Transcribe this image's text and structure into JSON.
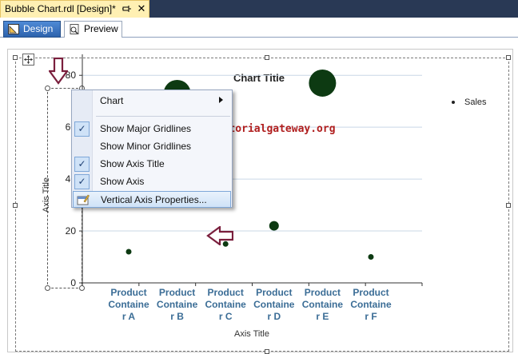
{
  "tabs": {
    "document_title": "Bubble Chart.rdl [Design]*",
    "pin_icon": "pin-icon",
    "close_icon": "close-icon",
    "close_glyph": "✕",
    "design_label": "Design",
    "preview_label": "Preview"
  },
  "context_menu": {
    "items": [
      {
        "label": "Chart",
        "checked": false,
        "submenu": true
      },
      {
        "label": "Show Major Gridlines",
        "checked": true
      },
      {
        "label": "Show Minor Gridlines",
        "checked": false
      },
      {
        "label": "Show Axis Title",
        "checked": true
      },
      {
        "label": "Show Axis",
        "checked": true
      },
      {
        "label": "Vertical Axis Properties...",
        "checked": false,
        "highlighted": true
      }
    ],
    "check_glyph": "✓"
  },
  "watermark": "©tutorialgateway.org",
  "chart_data": {
    "type": "scatter",
    "title": "Chart Title",
    "xlabel": "Axis Title",
    "ylabel": "Axis Title",
    "categories": [
      "Product Containe r A",
      "Product Containe r B",
      "Product Containe r C",
      "Product Containe r D",
      "Product Containe r E",
      "Product Containe r F"
    ],
    "category_lines": [
      [
        "Product",
        "Containe",
        "r A"
      ],
      [
        "Product",
        "Containe",
        "r B"
      ],
      [
        "Product",
        "Containe",
        "r C"
      ],
      [
        "Product",
        "Containe",
        "r D"
      ],
      [
        "Product",
        "Containe",
        "r E"
      ],
      [
        "Product",
        "Containe",
        "r F"
      ]
    ],
    "yticks": [
      "0",
      "20",
      "40",
      "60",
      "80"
    ],
    "ylim": [
      0,
      85
    ],
    "grid": true,
    "legend_position": "top-right",
    "series": [
      {
        "name": "Sales",
        "values": [
          12,
          73,
          15,
          22,
          77,
          10
        ],
        "sizes": [
          1,
          6,
          1,
          2,
          6,
          1
        ]
      }
    ],
    "colors": {
      "bubble": "#0d3a12",
      "grid": "#c9d7e6"
    }
  }
}
